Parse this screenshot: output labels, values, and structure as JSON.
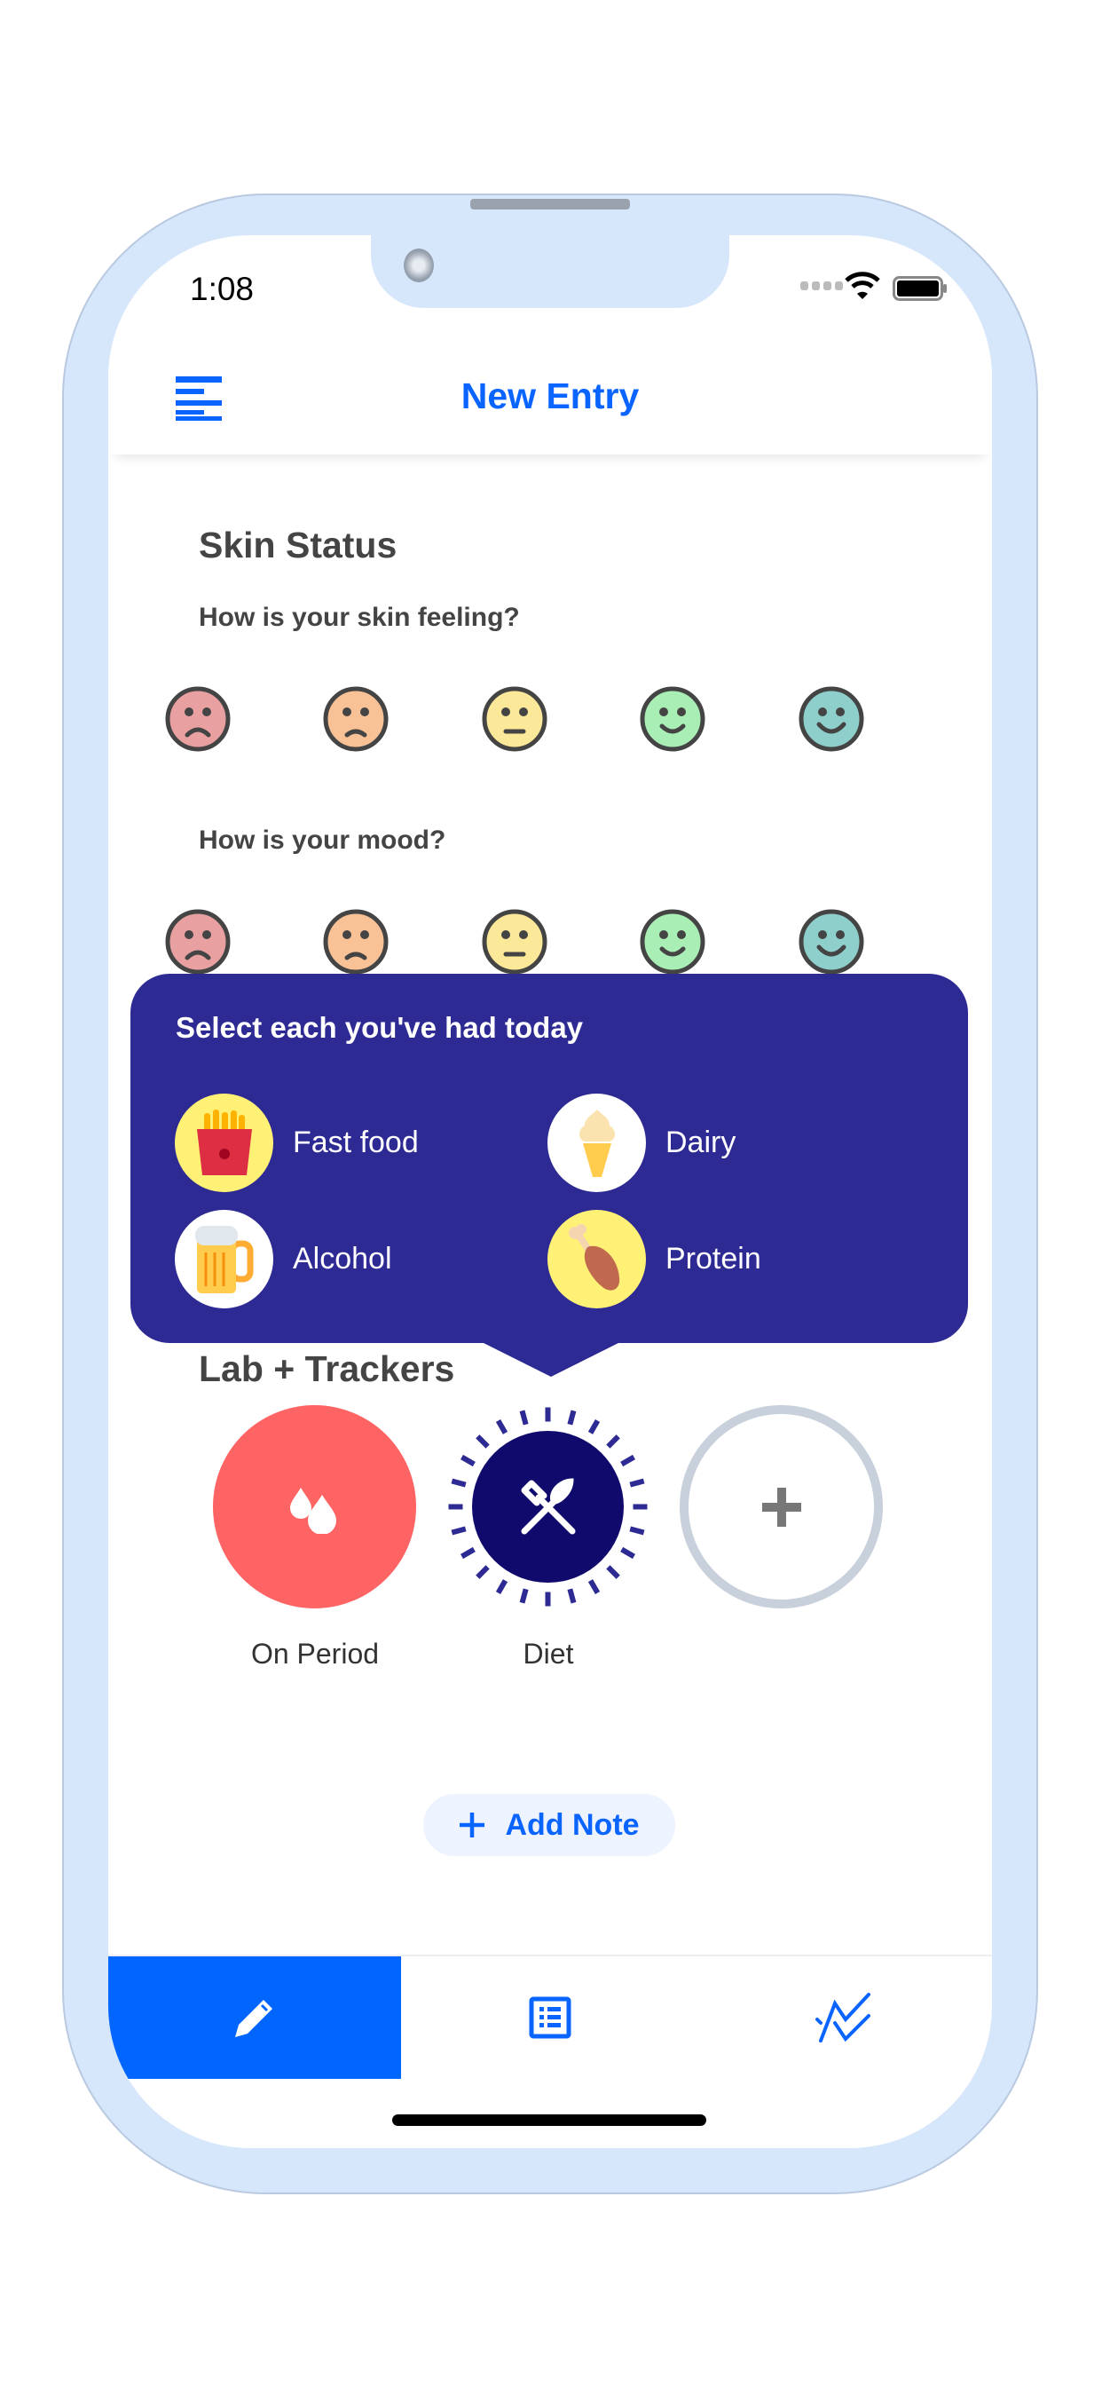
{
  "status_bar": {
    "time": "1:08",
    "icons": [
      "signal-dots-icon",
      "wifi-icon",
      "battery-icon"
    ]
  },
  "header": {
    "title": "New Entry",
    "menu_icon": "menu-lines-icon"
  },
  "skin_status": {
    "title": "Skin Status",
    "skin_question": "How is your skin feeling?",
    "mood_question": "How is your mood?",
    "faces": [
      {
        "name": "very-sad",
        "color": "#e8a0a0"
      },
      {
        "name": "sad",
        "color": "#f8c196"
      },
      {
        "name": "neutral",
        "color": "#fbe898"
      },
      {
        "name": "happy",
        "color": "#a9eeb5"
      },
      {
        "name": "very-happy",
        "color": "#8ecfcc"
      }
    ]
  },
  "trackers_title": "Lab + Trackers",
  "popup": {
    "title": "Select each you've had today",
    "options": [
      {
        "label": "Fast food",
        "icon": "fries-icon",
        "selected": true
      },
      {
        "label": "Dairy",
        "icon": "ice-cream-icon",
        "selected": false
      },
      {
        "label": "Alcohol",
        "icon": "beer-mug-icon",
        "selected": false
      },
      {
        "label": "Protein",
        "icon": "chicken-leg-icon",
        "selected": true
      }
    ],
    "selected_bg": "#fff176",
    "unselected_bg": "#ffffff",
    "bg": "#2e2a94"
  },
  "trackers": [
    {
      "label": "On Period",
      "icon": "blood-drops-icon",
      "color": "#ff6464"
    },
    {
      "label": "Diet",
      "icon": "fork-knife-icon",
      "color": "#0f0a6b"
    },
    {
      "label": "",
      "icon": "plus-icon",
      "color": "#c8d0dc"
    }
  ],
  "add_note": {
    "label": "Add Note",
    "icon": "plus-icon"
  },
  "tabs": [
    {
      "name": "new-entry",
      "icon": "pencil-icon",
      "active": true
    },
    {
      "name": "entries",
      "icon": "list-icon",
      "active": false
    },
    {
      "name": "trends",
      "icon": "trend-chart-icon",
      "active": false
    }
  ],
  "accent": "#0a64ff"
}
